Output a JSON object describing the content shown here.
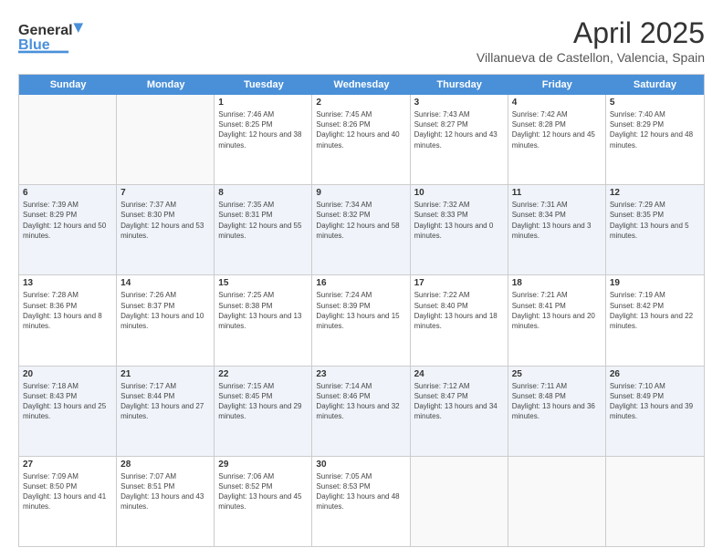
{
  "header": {
    "logo_general": "General",
    "logo_blue": "Blue",
    "title": "April 2025",
    "subtitle": "Villanueva de Castellon, Valencia, Spain"
  },
  "calendar": {
    "days": [
      "Sunday",
      "Monday",
      "Tuesday",
      "Wednesday",
      "Thursday",
      "Friday",
      "Saturday"
    ],
    "rows": [
      [
        {
          "day": "",
          "sunrise": "",
          "sunset": "",
          "daylight": "",
          "empty": true
        },
        {
          "day": "",
          "sunrise": "",
          "sunset": "",
          "daylight": "",
          "empty": true
        },
        {
          "day": "1",
          "sunrise": "Sunrise: 7:46 AM",
          "sunset": "Sunset: 8:25 PM",
          "daylight": "Daylight: 12 hours and 38 minutes."
        },
        {
          "day": "2",
          "sunrise": "Sunrise: 7:45 AM",
          "sunset": "Sunset: 8:26 PM",
          "daylight": "Daylight: 12 hours and 40 minutes."
        },
        {
          "day": "3",
          "sunrise": "Sunrise: 7:43 AM",
          "sunset": "Sunset: 8:27 PM",
          "daylight": "Daylight: 12 hours and 43 minutes."
        },
        {
          "day": "4",
          "sunrise": "Sunrise: 7:42 AM",
          "sunset": "Sunset: 8:28 PM",
          "daylight": "Daylight: 12 hours and 45 minutes."
        },
        {
          "day": "5",
          "sunrise": "Sunrise: 7:40 AM",
          "sunset": "Sunset: 8:29 PM",
          "daylight": "Daylight: 12 hours and 48 minutes."
        }
      ],
      [
        {
          "day": "6",
          "sunrise": "Sunrise: 7:39 AM",
          "sunset": "Sunset: 8:29 PM",
          "daylight": "Daylight: 12 hours and 50 minutes."
        },
        {
          "day": "7",
          "sunrise": "Sunrise: 7:37 AM",
          "sunset": "Sunset: 8:30 PM",
          "daylight": "Daylight: 12 hours and 53 minutes."
        },
        {
          "day": "8",
          "sunrise": "Sunrise: 7:35 AM",
          "sunset": "Sunset: 8:31 PM",
          "daylight": "Daylight: 12 hours and 55 minutes."
        },
        {
          "day": "9",
          "sunrise": "Sunrise: 7:34 AM",
          "sunset": "Sunset: 8:32 PM",
          "daylight": "Daylight: 12 hours and 58 minutes."
        },
        {
          "day": "10",
          "sunrise": "Sunrise: 7:32 AM",
          "sunset": "Sunset: 8:33 PM",
          "daylight": "Daylight: 13 hours and 0 minutes."
        },
        {
          "day": "11",
          "sunrise": "Sunrise: 7:31 AM",
          "sunset": "Sunset: 8:34 PM",
          "daylight": "Daylight: 13 hours and 3 minutes."
        },
        {
          "day": "12",
          "sunrise": "Sunrise: 7:29 AM",
          "sunset": "Sunset: 8:35 PM",
          "daylight": "Daylight: 13 hours and 5 minutes."
        }
      ],
      [
        {
          "day": "13",
          "sunrise": "Sunrise: 7:28 AM",
          "sunset": "Sunset: 8:36 PM",
          "daylight": "Daylight: 13 hours and 8 minutes."
        },
        {
          "day": "14",
          "sunrise": "Sunrise: 7:26 AM",
          "sunset": "Sunset: 8:37 PM",
          "daylight": "Daylight: 13 hours and 10 minutes."
        },
        {
          "day": "15",
          "sunrise": "Sunrise: 7:25 AM",
          "sunset": "Sunset: 8:38 PM",
          "daylight": "Daylight: 13 hours and 13 minutes."
        },
        {
          "day": "16",
          "sunrise": "Sunrise: 7:24 AM",
          "sunset": "Sunset: 8:39 PM",
          "daylight": "Daylight: 13 hours and 15 minutes."
        },
        {
          "day": "17",
          "sunrise": "Sunrise: 7:22 AM",
          "sunset": "Sunset: 8:40 PM",
          "daylight": "Daylight: 13 hours and 18 minutes."
        },
        {
          "day": "18",
          "sunrise": "Sunrise: 7:21 AM",
          "sunset": "Sunset: 8:41 PM",
          "daylight": "Daylight: 13 hours and 20 minutes."
        },
        {
          "day": "19",
          "sunrise": "Sunrise: 7:19 AM",
          "sunset": "Sunset: 8:42 PM",
          "daylight": "Daylight: 13 hours and 22 minutes."
        }
      ],
      [
        {
          "day": "20",
          "sunrise": "Sunrise: 7:18 AM",
          "sunset": "Sunset: 8:43 PM",
          "daylight": "Daylight: 13 hours and 25 minutes."
        },
        {
          "day": "21",
          "sunrise": "Sunrise: 7:17 AM",
          "sunset": "Sunset: 8:44 PM",
          "daylight": "Daylight: 13 hours and 27 minutes."
        },
        {
          "day": "22",
          "sunrise": "Sunrise: 7:15 AM",
          "sunset": "Sunset: 8:45 PM",
          "daylight": "Daylight: 13 hours and 29 minutes."
        },
        {
          "day": "23",
          "sunrise": "Sunrise: 7:14 AM",
          "sunset": "Sunset: 8:46 PM",
          "daylight": "Daylight: 13 hours and 32 minutes."
        },
        {
          "day": "24",
          "sunrise": "Sunrise: 7:12 AM",
          "sunset": "Sunset: 8:47 PM",
          "daylight": "Daylight: 13 hours and 34 minutes."
        },
        {
          "day": "25",
          "sunrise": "Sunrise: 7:11 AM",
          "sunset": "Sunset: 8:48 PM",
          "daylight": "Daylight: 13 hours and 36 minutes."
        },
        {
          "day": "26",
          "sunrise": "Sunrise: 7:10 AM",
          "sunset": "Sunset: 8:49 PM",
          "daylight": "Daylight: 13 hours and 39 minutes."
        }
      ],
      [
        {
          "day": "27",
          "sunrise": "Sunrise: 7:09 AM",
          "sunset": "Sunset: 8:50 PM",
          "daylight": "Daylight: 13 hours and 41 minutes."
        },
        {
          "day": "28",
          "sunrise": "Sunrise: 7:07 AM",
          "sunset": "Sunset: 8:51 PM",
          "daylight": "Daylight: 13 hours and 43 minutes."
        },
        {
          "day": "29",
          "sunrise": "Sunrise: 7:06 AM",
          "sunset": "Sunset: 8:52 PM",
          "daylight": "Daylight: 13 hours and 45 minutes."
        },
        {
          "day": "30",
          "sunrise": "Sunrise: 7:05 AM",
          "sunset": "Sunset: 8:53 PM",
          "daylight": "Daylight: 13 hours and 48 minutes."
        },
        {
          "day": "",
          "sunrise": "",
          "sunset": "",
          "daylight": "",
          "empty": true
        },
        {
          "day": "",
          "sunrise": "",
          "sunset": "",
          "daylight": "",
          "empty": true
        },
        {
          "day": "",
          "sunrise": "",
          "sunset": "",
          "daylight": "",
          "empty": true
        }
      ]
    ]
  }
}
